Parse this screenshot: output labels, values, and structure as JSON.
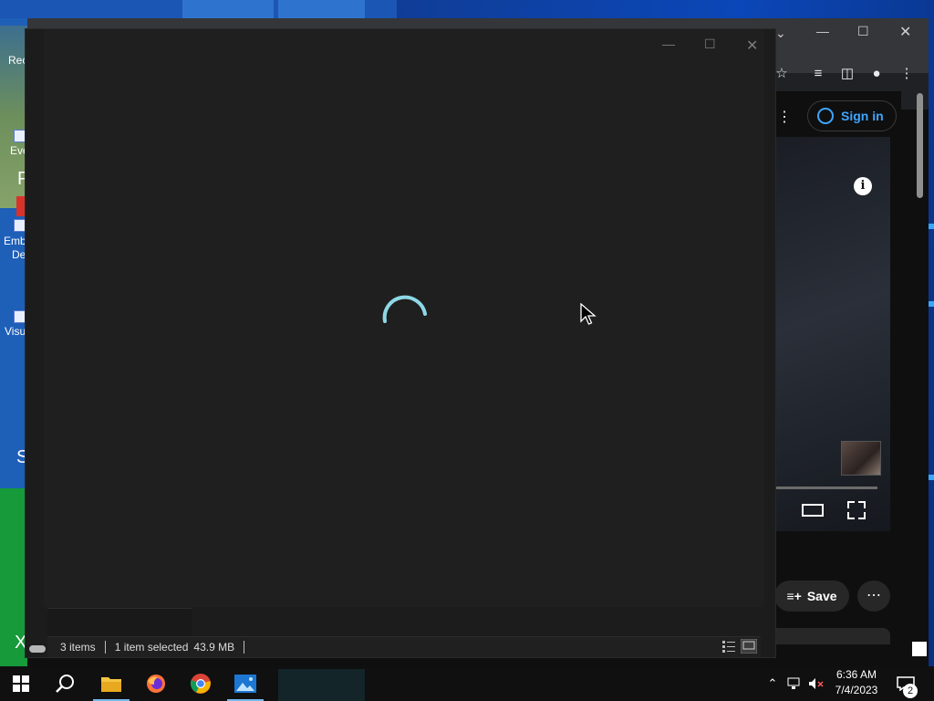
{
  "desktop": {
    "left_labels": [
      "Rec",
      "Eve",
      "P",
      "Emb",
      "De",
      "Visu",
      "S",
      "X"
    ]
  },
  "browser": {
    "signin_label": "Sign in",
    "save_label": "Save",
    "info_glyph": "i"
  },
  "explorer": {
    "status": {
      "items_count": "3 items",
      "selection": "1 item selected",
      "size": "43.9 MB"
    }
  },
  "taskbar": {
    "apps": [
      "windows-start",
      "search",
      "file-explorer",
      "firefox",
      "chrome",
      "photos"
    ],
    "clock_time": "6:36 AM",
    "clock_date": "7/4/2023",
    "notification_count": "2"
  },
  "colors": {
    "accent": "#76b9ed",
    "spinner": "#8ed8e6",
    "youtube_link": "#3ea6ff",
    "taskbar": "#101010"
  }
}
